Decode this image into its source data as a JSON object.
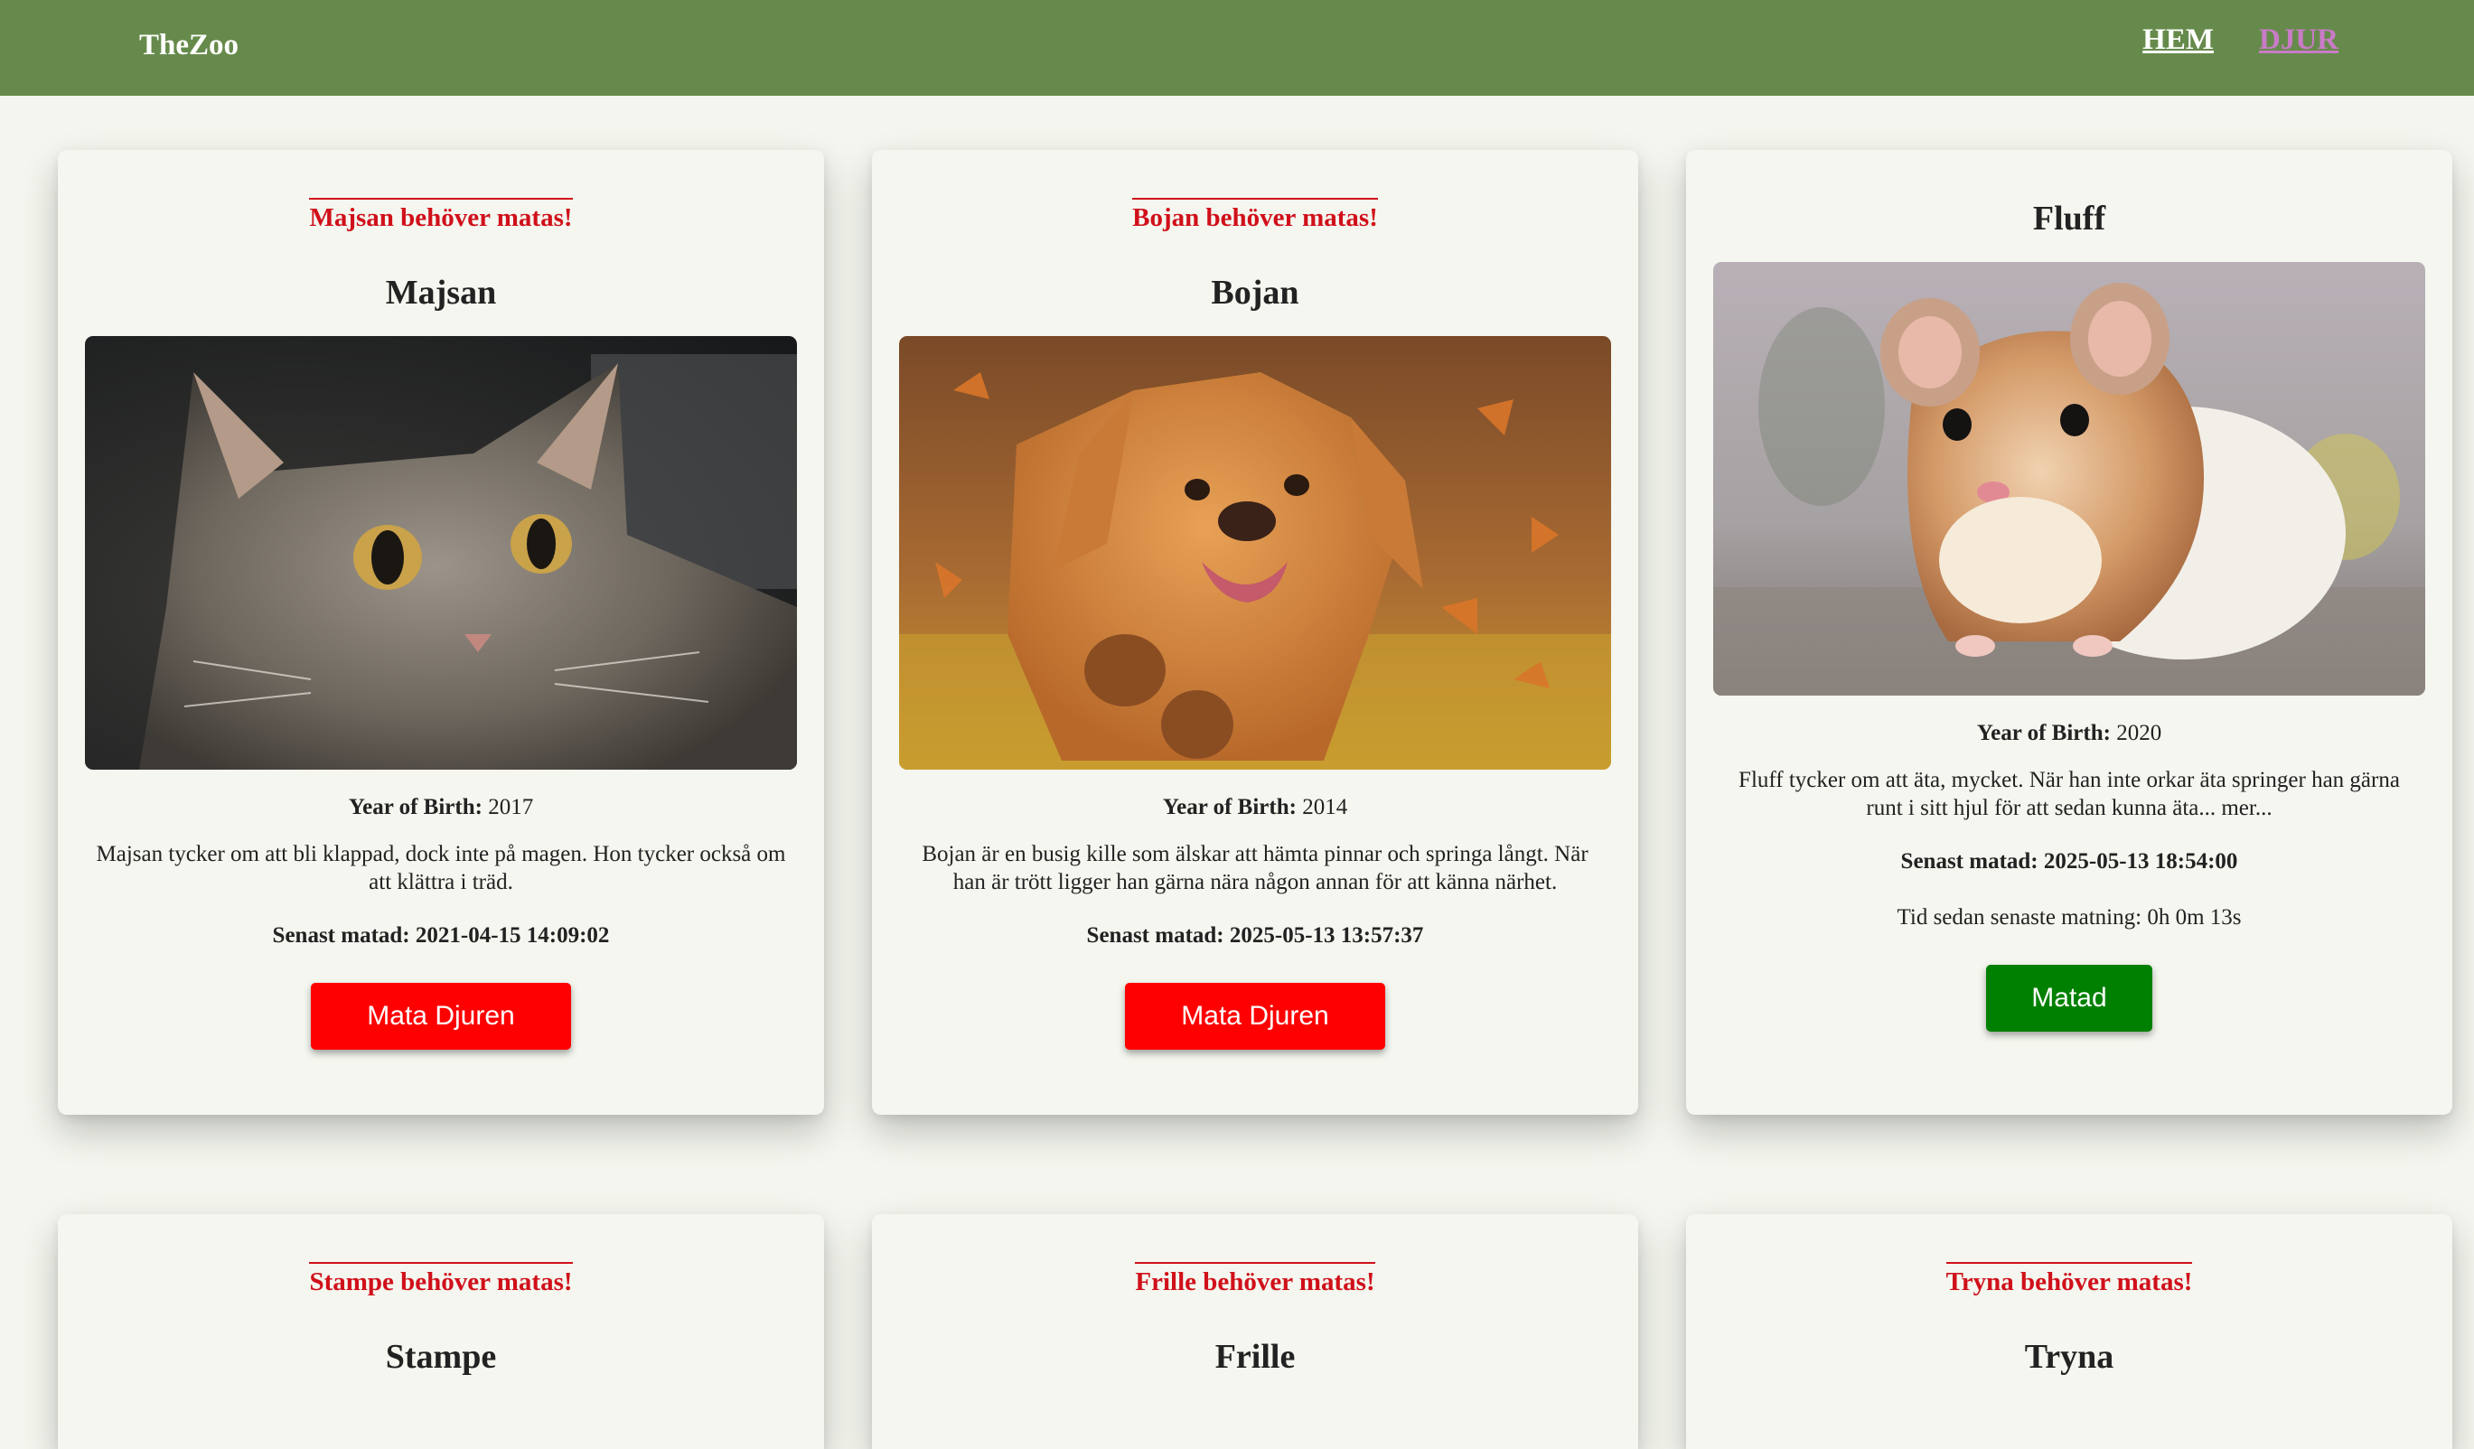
{
  "brand": "TheZoo",
  "nav": {
    "home": "HEM",
    "animals": "DJUR"
  },
  "labels": {
    "year_of_birth": "Year of Birth:",
    "last_fed_prefix": "Senast matad:"
  },
  "animals": [
    {
      "warning": "Majsan behöver matas!",
      "name": "Majsan",
      "photo_icon": "cat-photo",
      "year": "2017",
      "description": "Majsan tycker om att bli klappad, dock inte på magen. Hon tycker också om att klättra i träd.",
      "last_fed": "Senast matad: 2021-04-15 14:09:02",
      "button": "Mata Djuren",
      "button_color": "#fe0000"
    },
    {
      "warning": "Bojan behöver matas!",
      "name": "Bojan",
      "photo_icon": "dog-photo",
      "year": "2014",
      "description": "Bojan är en busig kille som älskar att hämta pinnar och springa långt. När han är trött ligger han gärna nära någon annan för att känna närhet.",
      "last_fed": "Senast matad: 2025-05-13 13:57:37",
      "button": "Mata Djuren",
      "button_color": "#fe0000"
    },
    {
      "warning": "",
      "name": "Fluff",
      "photo_icon": "hamster-photo",
      "year": "2020",
      "description": "Fluff tycker om att äta, mycket. När han inte orkar äta springer han gärna runt i sitt hjul för att sedan kunna äta... mer...",
      "last_fed": "Senast matad: 2025-05-13 18:54:00",
      "time_since": "Tid sedan senaste matning: 0h 0m 13s",
      "button": "Matad",
      "button_color": "#008000"
    },
    {
      "warning": "Stampe behöver matas!",
      "name": "Stampe"
    },
    {
      "warning": "Frille behöver matas!",
      "name": "Frille"
    },
    {
      "warning": "Tryna behöver matas!",
      "name": "Tryna"
    }
  ],
  "colors": {
    "navbar": "#668a4b",
    "warning": "#d0101a",
    "feed_button": "#fe0000",
    "fed_button": "#008000",
    "active_nav": "#c87bc6"
  }
}
